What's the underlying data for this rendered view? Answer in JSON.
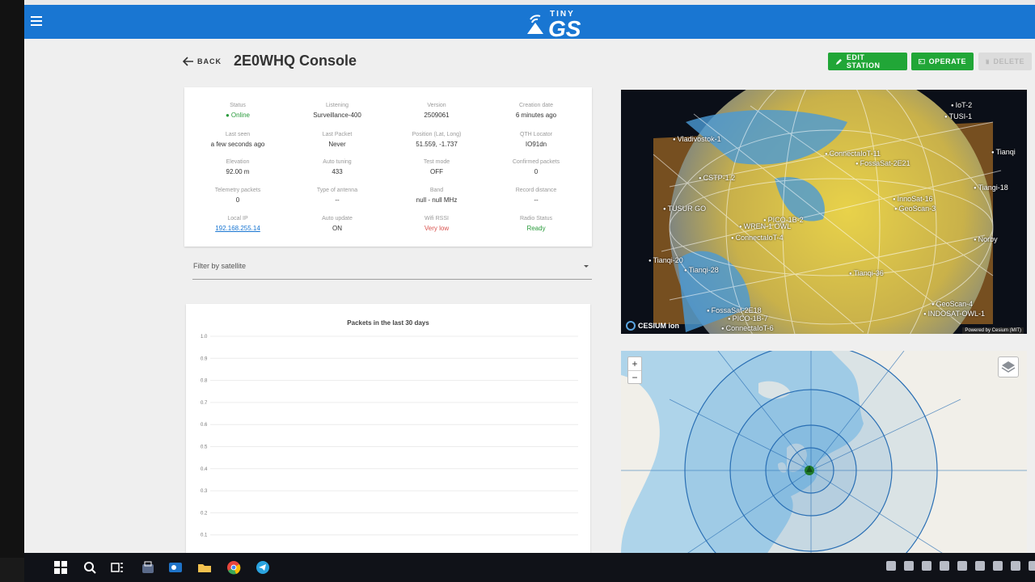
{
  "app": {
    "logo_small": "TINY",
    "logo_big": "GS"
  },
  "header": {
    "back_label": "BACK",
    "title": "2E0WHQ Console",
    "edit_label": "EDIT STATION",
    "operate_label": "OPERATE",
    "delete_label": "DELETE"
  },
  "info": [
    {
      "label": "Status",
      "value": "Online",
      "style": "online"
    },
    {
      "label": "Listening",
      "value": "Surveillance-400",
      "style": ""
    },
    {
      "label": "Version",
      "value": "2509061",
      "style": ""
    },
    {
      "label": "Creation date",
      "value": "6 minutes ago",
      "style": ""
    },
    {
      "label": "Last seen",
      "value": "a few seconds ago",
      "style": ""
    },
    {
      "label": "Last Packet",
      "value": "Never",
      "style": ""
    },
    {
      "label": "Position (Lat, Long)",
      "value": "51.559, -1.737",
      "style": ""
    },
    {
      "label": "QTH Locator",
      "value": "IO91dn",
      "style": ""
    },
    {
      "label": "Elevation",
      "value": "92.00 m",
      "style": ""
    },
    {
      "label": "Auto tuning",
      "value": "433",
      "style": ""
    },
    {
      "label": "Test mode",
      "value": "OFF",
      "style": ""
    },
    {
      "label": "Confirmed packets",
      "value": "0",
      "style": ""
    },
    {
      "label": "Telemetry packets",
      "value": "0",
      "style": ""
    },
    {
      "label": "Type of antenna",
      "value": "--",
      "style": ""
    },
    {
      "label": "Band",
      "value": "null - null MHz",
      "style": ""
    },
    {
      "label": "Record distance",
      "value": "--",
      "style": ""
    },
    {
      "label": "Local IP",
      "value": "192.168.255.14",
      "style": "link"
    },
    {
      "label": "Auto update",
      "value": "ON",
      "style": ""
    },
    {
      "label": "Wifi RSSI",
      "value": "Very low",
      "style": "red"
    },
    {
      "label": "Radio Status",
      "value": "Ready",
      "style": "green"
    }
  ],
  "filter": {
    "label": "Filter by satellite"
  },
  "chart_data": {
    "type": "line",
    "title": "Packets in the last 30 days",
    "xlabel": "",
    "ylabel": "",
    "ylim": [
      0,
      1.0
    ],
    "yticks": [
      "1.0",
      "0.9",
      "0.8",
      "0.7",
      "0.6",
      "0.5",
      "0.4",
      "0.3",
      "0.2",
      "0.1"
    ],
    "series": []
  },
  "globe": {
    "credit": "CESIUM ion",
    "powered": "Powered by Cesium (MIT)",
    "satellites": [
      "IoT-2",
      "TUSI-1",
      "Tianqi",
      "Tiangi-18",
      "Norby",
      "ConnectaIoT-11",
      "FossaSat-2E21",
      "Vladivostok-1",
      "CSTP-1.2",
      "TUSUR GO",
      "PICO-1B-2",
      "WREN-1 OWL",
      "ConnectaIoT-4",
      "InnoSat-16",
      "GeoScan-3",
      "Tianqi-20",
      "Tianqi-28",
      "Tianqi-36",
      "FossaSat-2E18",
      "PICO-1B-7",
      "GeoScan-4",
      "INDOSAT-OWL-1",
      "ConnectaIoT-6"
    ]
  },
  "map": {
    "zoom_in": "+",
    "zoom_out": "−"
  },
  "colors": {
    "appbar": "#1976d2",
    "action_green": "#21a637",
    "online_green": "#2a9b3c",
    "warning_red": "#d9534f"
  }
}
